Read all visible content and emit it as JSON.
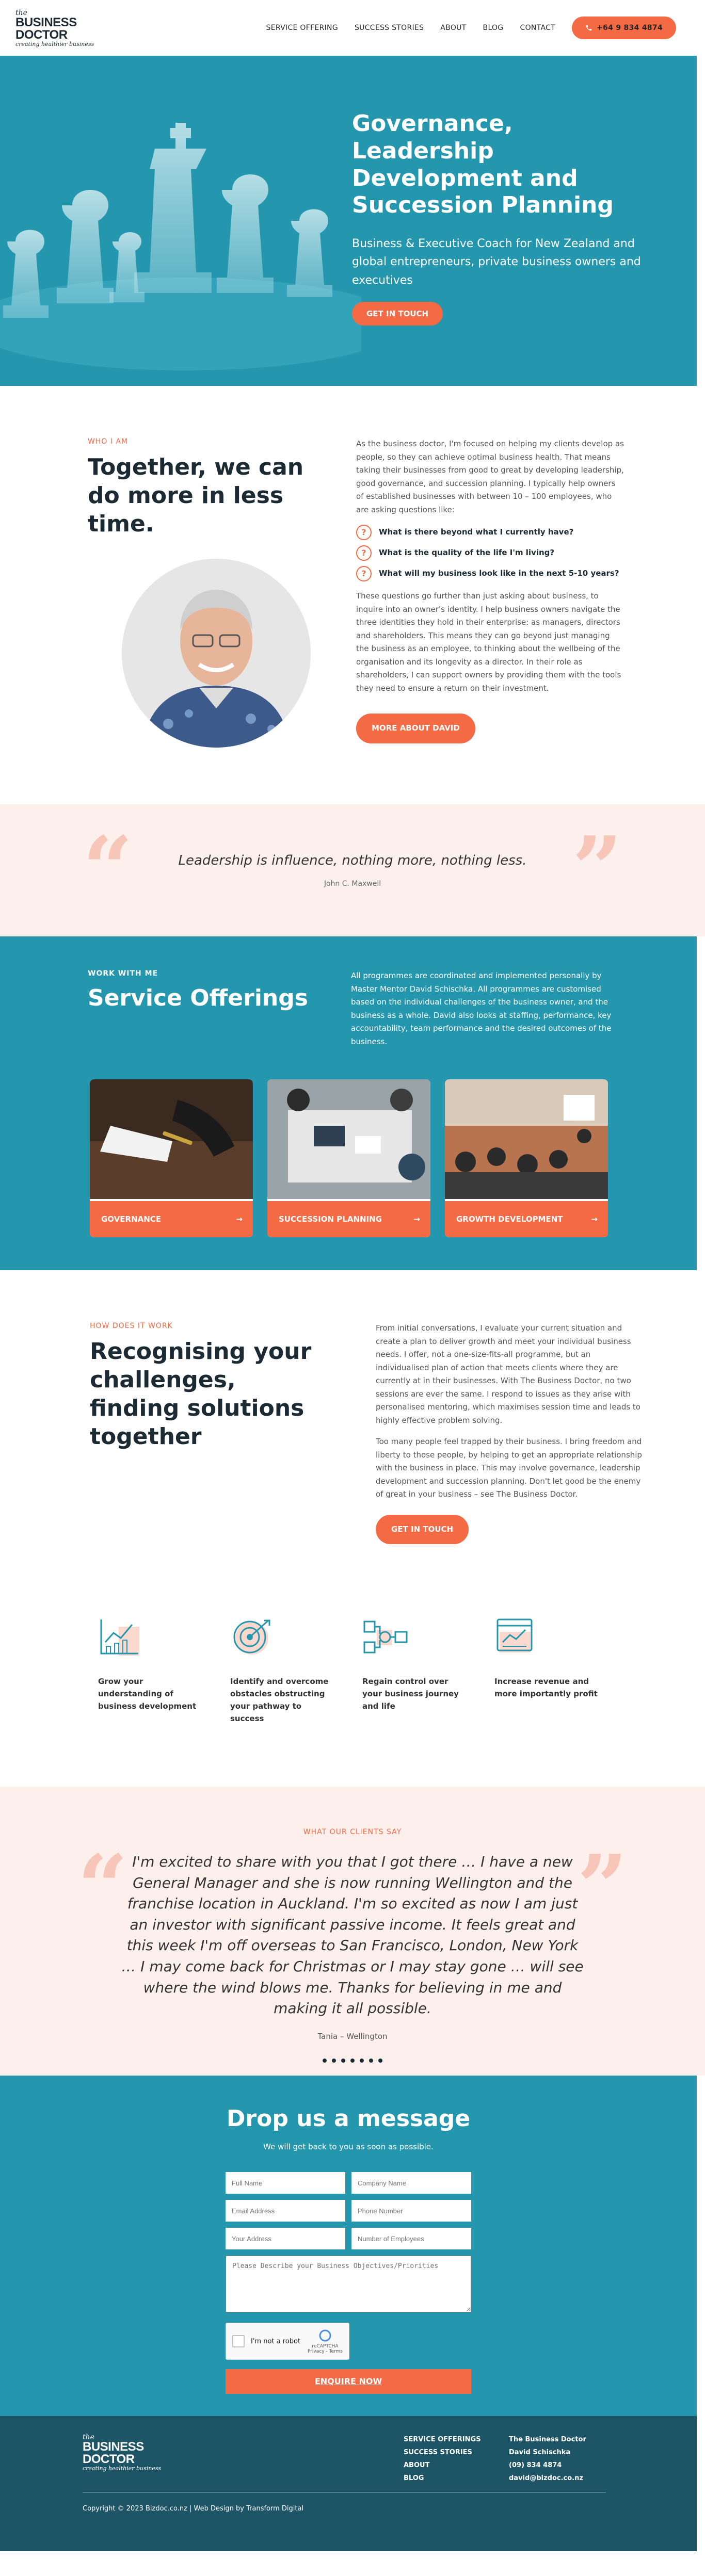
{
  "header": {
    "logo": {
      "the": "the",
      "name_line1": "BUSINESS",
      "name_line2": "DOCTOR",
      "tagline": "creating healthier business"
    },
    "nav": [
      "SERVICE OFFERING",
      "SUCCESS STORIES",
      "ABOUT",
      "BLOG",
      "CONTACT"
    ],
    "phone": "+64 9 834 4874",
    "phone_icon": "phone-icon"
  },
  "hero": {
    "title": "Governance, Leadership Development and Succession Planning",
    "subtitle": "Business & Executive Coach for New Zealand and global entrepreneurs, private business owners and executives",
    "cta": "GET IN TOUCH"
  },
  "about": {
    "eyebrow": "WHO I AM",
    "title": "Together, we can do more in less time.",
    "intro": "As the business doctor, I'm focused on helping my clients develop as people, so they can achieve optimal business health. That means taking their businesses from good to great by developing leadership, good governance, and succession planning. I typically help owners of established businesses with between 10 – 100 employees, who are asking questions like:",
    "questions": [
      "What is there beyond what I currently have?",
      "What is the quality of the life I'm living?",
      "What will my business look like in the next 5-10 years?"
    ],
    "body": "These questions go further than just asking about business, to inquire into an owner's identity. I help business owners navigate the three identities they hold in their enterprise: as managers, directors and shareholders. This means they can go beyond just managing the business as an employee, to thinking about the wellbeing of the organisation and its longevity as a director. In their role as shareholders, I can support owners by providing them with the tools they need to ensure a return on their investment.",
    "cta": "MORE ABOUT DAVID"
  },
  "quote": {
    "text": "Leadership is influence, nothing more, nothing less.",
    "author": "John C. Maxwell"
  },
  "services": {
    "eyebrow": "WORK WITH ME",
    "title": "Service Offerings",
    "description": "All programmes are coordinated and implemented personally by Master Mentor David Schischka. All programmes are customised based on the individual challenges of the business owner, and the business as a whole. David also looks at staffing, performance, key accountability, team performance and the desired outcomes of the business.",
    "cards": [
      {
        "label": "GOVERNANCE"
      },
      {
        "label": "SUCCESSION PLANNING"
      },
      {
        "label": "GROWTH DEVELOPMENT"
      }
    ],
    "arrow": "→"
  },
  "how": {
    "eyebrow": "HOW DOES IT WORK",
    "title": "Recognising your challenges, finding solutions together",
    "p1": "From initial conversations, I evaluate your current situation and create a plan to deliver growth and meet your individual business needs. I offer, not a one-size-fits-all programme, but an individualised plan of action that meets clients where they are currently at in their businesses. With The Business Doctor, no two sessions are ever the same. I respond to issues as they arise with personalised mentoring, which maximises session time and leads to highly effective problem solving.",
    "p2": "Too many people feel trapped by their business. I bring freedom and liberty to those people, by helping to get an appropriate relationship with the business in place. This may involve governance, leadership development and succession planning. Don't let good be the enemy of great in your business – see The Business Doctor.",
    "cta": "GET IN TOUCH"
  },
  "features": [
    {
      "icon": "growth-chart-icon",
      "text": "Grow your understanding of business development"
    },
    {
      "icon": "target-icon",
      "text": "Identify and overcome obstacles obstructing your pathway to success"
    },
    {
      "icon": "workflow-icon",
      "text": "Regain control over your business journey and life"
    },
    {
      "icon": "report-icon",
      "text": "Increase revenue and more importantly profit"
    }
  ],
  "testimonials": {
    "eyebrow": "WHAT OUR CLIENTS SAY",
    "text": "I'm excited to share with you that I got there … I have a new General Manager and she is now running Wellington and the franchise location in Auckland. I'm so excited as now I am just an investor with significant passive income. It feels great and this week I'm off overseas to San Francisco, London, New York … I may come back for Christmas or I may stay gone … will see where the wind blows me. Thanks for believing in me and making it all possible.",
    "author": "Tania – Wellington",
    "dots": 7
  },
  "contact": {
    "title": "Drop us a message",
    "subtitle": "We will get back to you as soon as possible.",
    "fields": {
      "full_name": "Full Name",
      "company": "Company Name",
      "email": "Email Address",
      "phone": "Phone Number",
      "address": "Your Address",
      "employees": "Number of Employees",
      "message": "Please Describe your Business Objectives/Priorities"
    },
    "captcha": {
      "label": "I'm not a robot",
      "brand": "reCAPTCHA",
      "links": "Privacy - Terms"
    },
    "submit": "ENQUIRE NOW"
  },
  "footer": {
    "links": [
      "SERVICE OFFERINGS",
      "SUCCESS STORIES",
      "ABOUT",
      "BLOG"
    ],
    "info": [
      "The Business Doctor",
      "David Schischka",
      "(09) 834 4874",
      "david@bizdoc.co.nz"
    ],
    "copyright": "Copyright © 2023 Bizdoc.co.nz | Web Design by Transform Digital"
  },
  "colors": {
    "teal": "#2497ae",
    "orange": "#f46a45",
    "navy": "#1e5566",
    "blush": "#fdf0ec"
  }
}
